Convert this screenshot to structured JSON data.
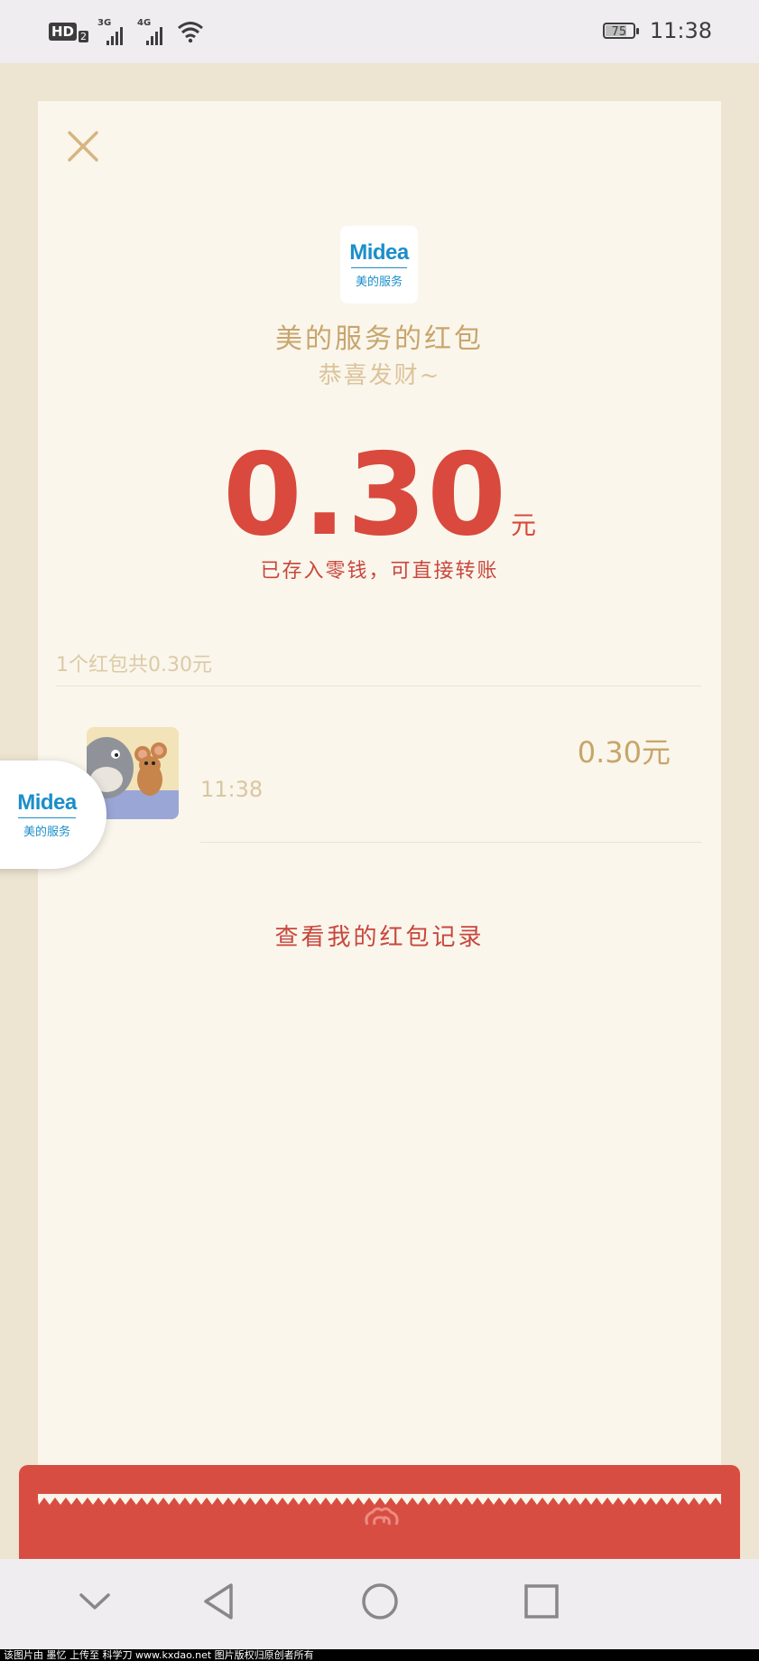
{
  "status_bar": {
    "hd_label": "HD",
    "hd_sub": "2",
    "network_1": "3G",
    "network_2": "4G",
    "battery": "75",
    "battery_level": 0.75,
    "time": "11:38"
  },
  "packet": {
    "logo_text": "Midea",
    "logo_sub": "美的服务",
    "sender": "美的服务的红包",
    "greeting": "恭喜发财~",
    "amount": "0.30",
    "unit": "元",
    "note": "已存入零钱，可直接转账"
  },
  "summary": "1个红包共0.30元",
  "records": [
    {
      "time": "11:38",
      "amount": "0.30元"
    }
  ],
  "view_records_link": "查看我的红包记录",
  "float": {
    "logo_text": "Midea",
    "logo_sub": "美的服务"
  },
  "watermark": "该图片由 墨忆 上传至 科学刀 www.kxdao.net 图片版权归原创者所有",
  "colors": {
    "accent_red": "#d9493d",
    "gold": "#c8a56d",
    "card_bg": "#faf6ec",
    "page_bg": "#ede4d1"
  },
  "icons": [
    "close-icon",
    "chevron-down-icon",
    "back-icon",
    "home-icon",
    "recents-icon",
    "wifi-icon",
    "signal-icon",
    "battery-icon"
  ]
}
